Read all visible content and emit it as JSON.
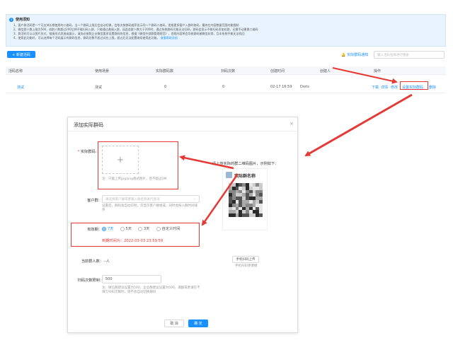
{
  "notice": {
    "title": "使用须知",
    "lines": [
      "1、客户群活码是一个可支持长期使用的二维码，当一个群码上限后会自动切换，会依次按群码顺序显示同一个群码二维码，类推更多客户入群时取码，最终在内容数量范围内能限制",
      "2、微信群人数上限为500，创群人数超过200后将不能扫码入群，只能通过邀请入群，因此若群人数大于200时，通过系统群码可能无法扫码，群码会显示不能扫码添加拉群，无需手动更换二维码",
      "3、群活码可以以图片形式、链接形式发放或展示，请务必按照企业微信要求设置群码的信息，根据《微信外部群管理规范》，违规内容将会导致群码被微信封禁，且本系统不能无法找回",
      "4、使用此功能时，可以选择每个活码展示的群码信息，群码总数不超过对应上限，超过后无法配置继续使用此功能。",
      "查看帮助文档"
    ]
  },
  "toolbar": {
    "create_label": "+ 新建活码",
    "notify_label": "实际群码通知",
    "search_placeholder": "输入活码名称进行搜索"
  },
  "table": {
    "headers": [
      "活码名称",
      "使用场景",
      "实际群码数",
      "扫码次数",
      "创建时间",
      "创建人",
      "操作"
    ],
    "rows": [
      {
        "name": "测试",
        "scene": "测试",
        "group_count": "0",
        "scan_count": "0",
        "created_at": "02-17 16:59",
        "creator": "Doris",
        "actions": [
          "下载",
          "详情",
          "修改",
          "设置实际群码",
          "删除"
        ]
      }
    ]
  },
  "modal": {
    "title": "添加实际群码",
    "close": "×",
    "qr_label": "实际群码：",
    "upload_plus": "+",
    "upload_hint": "注：只能上传jpg/png格式图片，且不超过2M",
    "customer_group_label": "客户群：",
    "customer_group_placeholder": "请选择客户群或者输入群名称进行查询",
    "customer_group_hint": "设置后，群码会自动识别，仅显示客户群组成，同时会按入群时间排序",
    "validity_label": "有效期：",
    "validity_options": [
      "7天",
      "5天",
      "3天",
      "自定义时间"
    ],
    "validity_selected": 0,
    "expire_text": "到期时间为：2022-03-03 23:59:59",
    "current_members_label": "当前群人数：",
    "current_members_value": "--人",
    "scan_limit_label": "扫码次数限制：",
    "scan_limit_value": "500",
    "scan_limit_hint": "注：微信群建议设置为500，企业群建议设置为500，满额或者请在不填写扫码次数时，则不会自动切换群码",
    "cancel_label": "取 消",
    "confirm_label": "确 定",
    "preview_title": "请上传实际的群二维码图片，示例如下：",
    "preview_group_name": "实际群名称",
    "preview_upload_btn": "手机扫码上传",
    "preview_upload_hint": "手机扫码更便捷"
  },
  "colors": {
    "primary": "#1890ff",
    "highlight": "#e53935"
  }
}
